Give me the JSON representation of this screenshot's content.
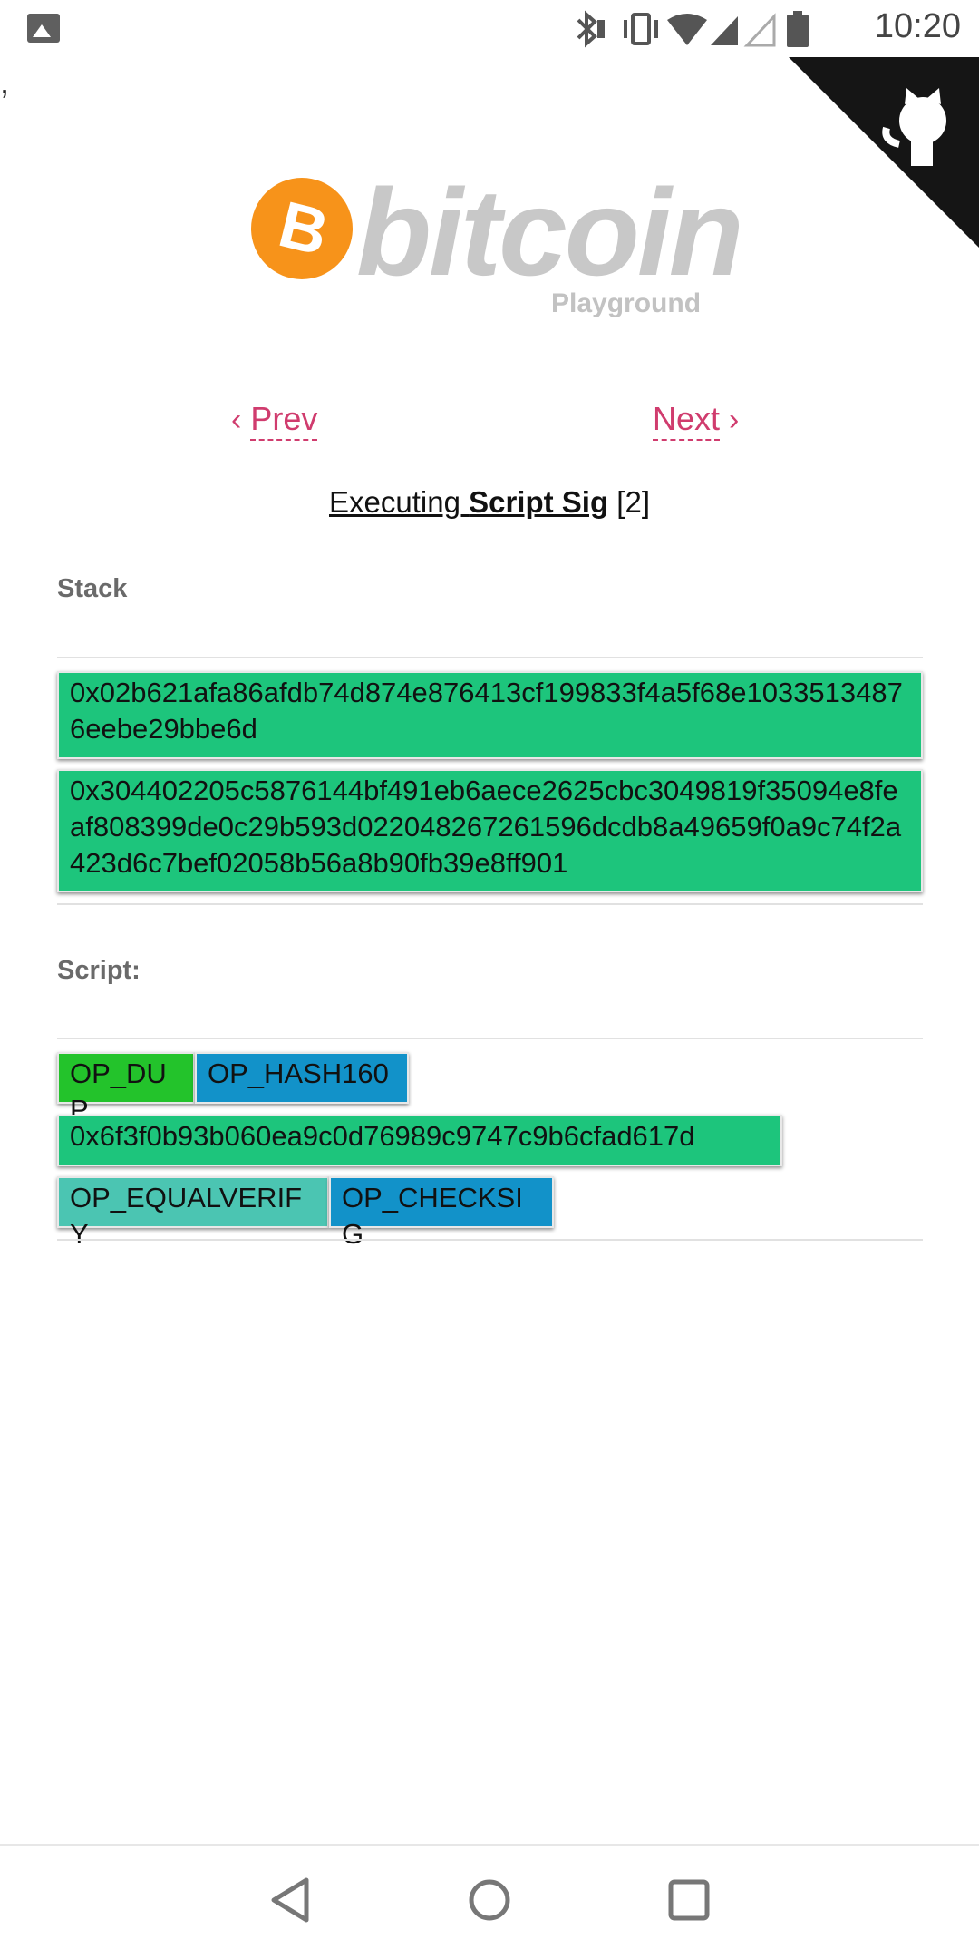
{
  "status_bar": {
    "time": "10:20",
    "icons": [
      "photo-icon",
      "bluetooth-icon",
      "vibrate-icon",
      "wifi-icon",
      "signal-icon",
      "signal-empty-icon",
      "battery-icon"
    ]
  },
  "stray_mark": ",",
  "logo": {
    "wordmark": "bitcoin",
    "subtitle": "Playground",
    "coin_symbol": "₿",
    "coin_color": "#f7931a"
  },
  "nav": {
    "prev_label": "Prev",
    "next_label": "Next",
    "prev_chevron": "‹",
    "next_chevron": "›",
    "link_color": "#d03c6e"
  },
  "executing": {
    "prefix": "Executing ",
    "target": "Script Sig",
    "step": " [2]"
  },
  "stack": {
    "label": "Stack",
    "items": [
      "0x02b621afa86afdb74d874e876413cf199833f4a5f68e10335134876eebe29bbe6d",
      "0x304402205c5876144bf491eb6aece2625cbc3049819f35094e8feaf808399de0c29b593d022048267261596dcdb8a49659f0a9c74f2a423d6c7bef02058b56a8b90fb39e8ff901"
    ]
  },
  "script": {
    "label": "Script:",
    "items": [
      {
        "text": "OP_DUP",
        "color": "#23c32b"
      },
      {
        "text": "OP_HASH160",
        "color": "#1292c9"
      },
      {
        "text": "0x6f3f0b93b060ea9c0d76989c9747c9b6cfad617d",
        "color": "#1dc57c"
      },
      {
        "text": "OP_EQUALVERIFY",
        "color": "#4bc5b2"
      },
      {
        "text": "OP_CHECKSIG",
        "color": "#1292c9"
      }
    ]
  },
  "navbar": {
    "buttons": [
      "back-icon",
      "home-icon",
      "recents-icon"
    ]
  }
}
